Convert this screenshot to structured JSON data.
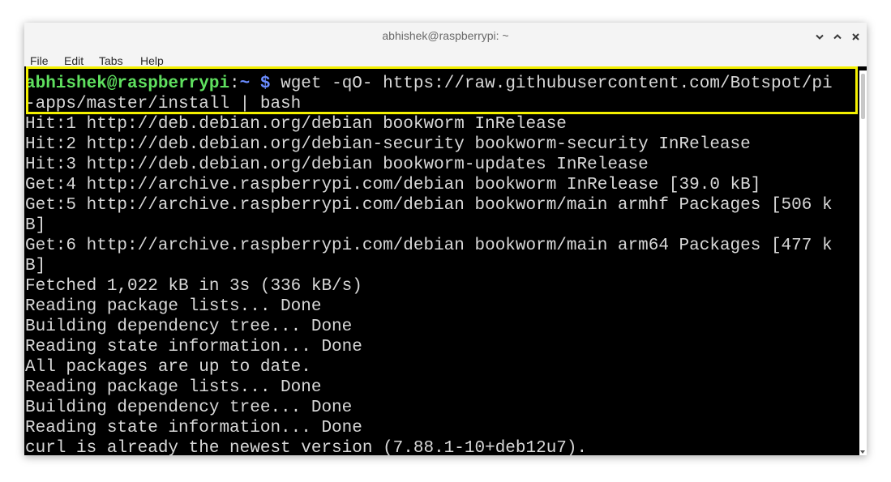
{
  "window": {
    "title": "abhishek@raspberrypi: ~"
  },
  "controls": {
    "minimize_icon": "chevron-down-icon",
    "maximize_icon": "chevron-up-icon",
    "close_icon": "close-icon"
  },
  "menu": {
    "file": "File",
    "edit": "Edit",
    "tabs": "Tabs",
    "help": "Help"
  },
  "prompt": {
    "user_host": "abhishek@raspberrypi",
    "colon": ":",
    "path": "~",
    "dollar": "$",
    "command_line1": " wget -qO- https://raw.githubusercontent.com/Botspot/pi",
    "command_line2": "-apps/master/install | bash"
  },
  "output": [
    "Hit:1 http://deb.debian.org/debian bookworm InRelease",
    "Hit:2 http://deb.debian.org/debian-security bookworm-security InRelease",
    "Hit:3 http://deb.debian.org/debian bookworm-updates InRelease",
    "Get:4 http://archive.raspberrypi.com/debian bookworm InRelease [39.0 kB]",
    "Get:5 http://archive.raspberrypi.com/debian bookworm/main armhf Packages [506 k",
    "B]",
    "Get:6 http://archive.raspberrypi.com/debian bookworm/main arm64 Packages [477 k",
    "B]",
    "Fetched 1,022 kB in 3s (336 kB/s)",
    "Reading package lists... Done",
    "Building dependency tree... Done",
    "Reading state information... Done",
    "All packages are up to date.",
    "Reading package lists... Done",
    "Building dependency tree... Done",
    "Reading state information... Done",
    "curl is already the newest version (7.88.1-10+deb12u7)."
  ],
  "colors": {
    "highlight": "#f4f000",
    "prompt_user": "#5fe05f",
    "prompt_path": "#6a8cff",
    "terminal_bg": "#000000",
    "terminal_fg": "#d8d8d8"
  }
}
